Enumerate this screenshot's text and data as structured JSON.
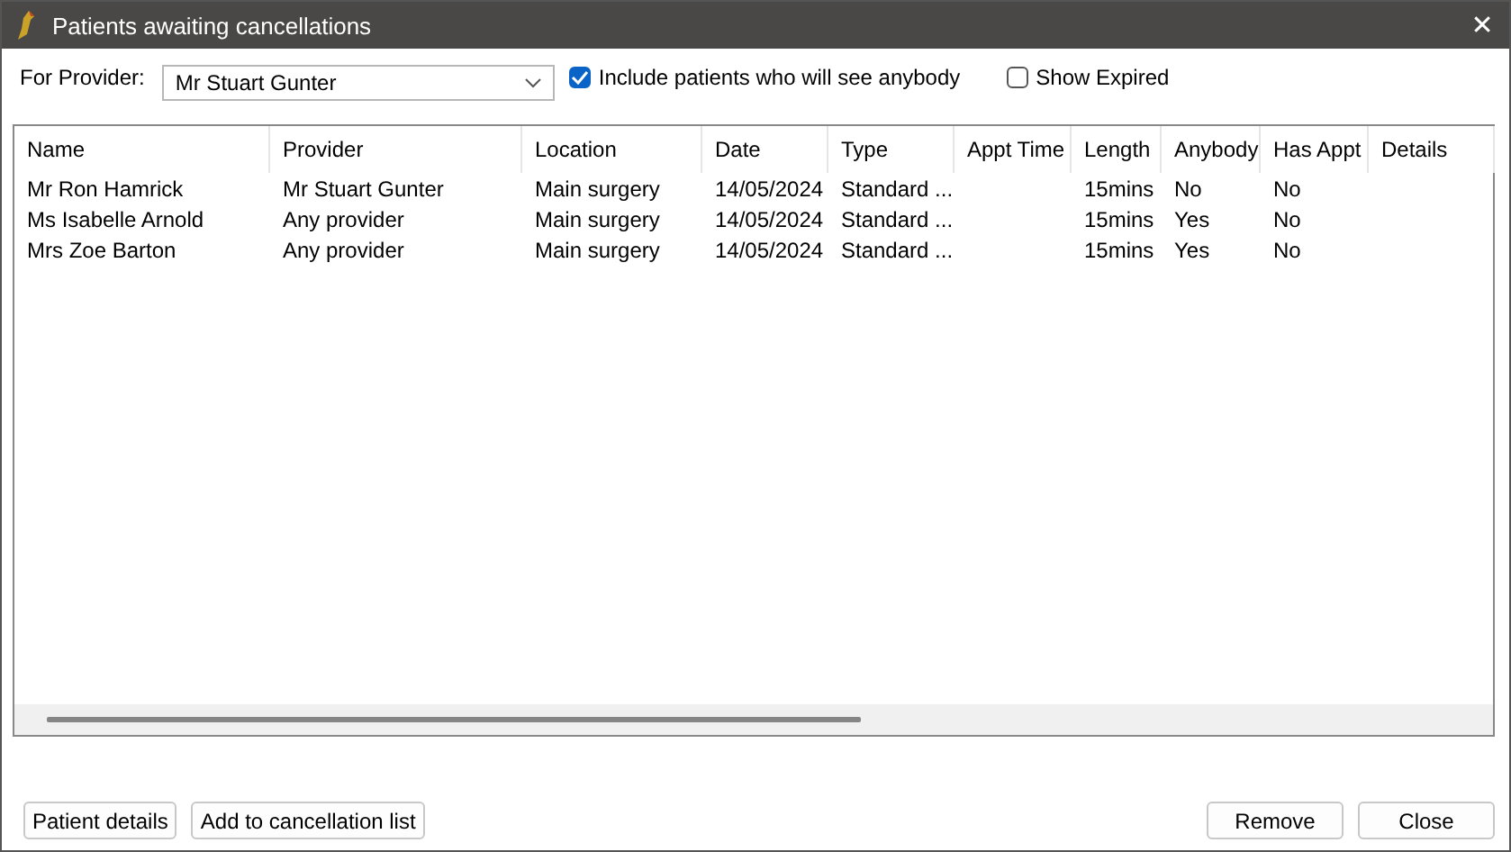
{
  "window": {
    "title": "Patients awaiting cancellations",
    "close": "✕"
  },
  "filters": {
    "provider_label": "For Provider:",
    "provider_value": "Mr Stuart Gunter",
    "options": [
      {
        "label": "Include patients who will see anybody",
        "checked": true
      },
      {
        "label": "Show Expired",
        "checked": false
      }
    ]
  },
  "table": {
    "columns": [
      "Name",
      "Provider",
      "Location",
      "Date",
      "Type",
      "Appt Time",
      "Length",
      "Anybody",
      "Has Appt",
      "Details"
    ],
    "rows": [
      [
        "Mr Ron Hamrick",
        "Mr Stuart Gunter",
        "Main surgery",
        "14/05/2024",
        "Standard ...",
        "",
        "15mins",
        "No",
        "No",
        ""
      ],
      [
        "Ms Isabelle Arnold",
        "Any provider",
        "Main surgery",
        "14/05/2024",
        "Standard ...",
        "",
        "15mins",
        "Yes",
        "No",
        ""
      ],
      [
        "Mrs Zoe Barton",
        "Any provider",
        "Main surgery",
        "14/05/2024",
        "Standard ...",
        "",
        "15mins",
        "Yes",
        "No",
        ""
      ]
    ]
  },
  "buttons_left": [
    "Patient details",
    "Add to cancellation list"
  ],
  "buttons_right": [
    "Remove",
    "Close"
  ]
}
